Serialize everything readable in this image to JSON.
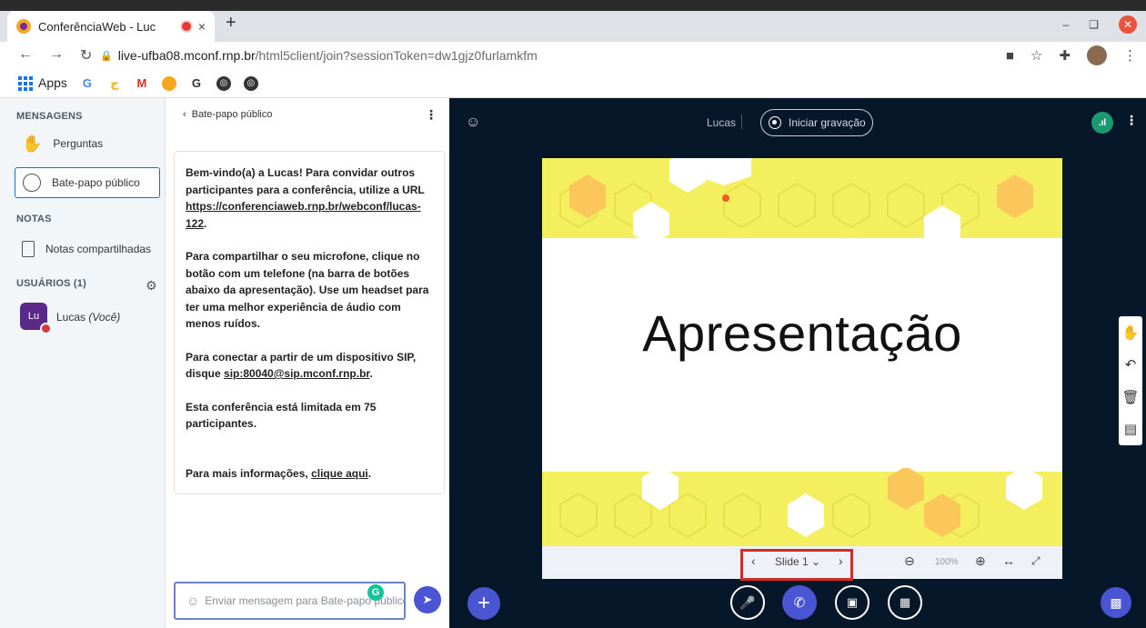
{
  "browser": {
    "tab_title": "ConferênciaWeb - Luc",
    "tab_close": "×",
    "new_tab": "+",
    "url_host": "live-ufba08.mconf.rnp.br",
    "url_path": "/html5client/join?sessionToken=dw1gjz0furlamkfm",
    "bookmarks_apps": "Apps",
    "bookmarks": [
      "G",
      "G",
      "M",
      "",
      "G",
      "",
      ""
    ]
  },
  "sidebar": {
    "messages_header": "MENSAGENS",
    "questions_label": "Perguntas",
    "public_chat_label": "Bate-papo público",
    "notes_header": "NOTAS",
    "shared_notes_label": "Notas compartilhadas",
    "users_header": "USUÁRIOS (1)",
    "user_initials": "Lu",
    "user_name": "Lucas",
    "user_you": "(Você)"
  },
  "chat": {
    "header": "Bate-papo público",
    "welcome_p1_a": "Bem-vindo(a) a ",
    "welcome_p1_name": "Lucas",
    "welcome_p1_b": "! Para convidar outros participantes para a conferência, utilize a URL ",
    "welcome_p1_url": "https://conferenciaweb.rnp.br/webconf/lucas-122",
    "welcome_p1_end": ".",
    "welcome_p2": "Para compartilhar o seu microfone, clique no botão com um telefone (na barra de botões abaixo da apresentação). Use um headset para ter uma melhor experiência de áudio com menos ruídos.",
    "welcome_p3_a": "Para conectar a partir de um dispositivo SIP, disque ",
    "welcome_p3_sip": "sip:80040@sip.mconf.rnp.br",
    "welcome_p3_end": ".",
    "welcome_p4_a": "Esta conferência está limitada em ",
    "welcome_p4_num": "75 participantes",
    "welcome_p4_end": ".",
    "welcome_p5_a": "Para mais informações, ",
    "welcome_p5_link": "clique aqui",
    "welcome_p5_end": ".",
    "input_placeholder": "Enviar mensagem para Bate-papo público"
  },
  "main": {
    "presenter_name": "Lucas",
    "record_label": "Iniciar gravação",
    "slide_title": "Apresentação",
    "slide_selector": "Slide 1",
    "zoom_value": "100%"
  },
  "colors": {
    "accent": "#4a55d4",
    "dark_bg": "#06172a",
    "slide_yellow": "#f3ef5e",
    "highlight_red": "#d42a2a"
  }
}
